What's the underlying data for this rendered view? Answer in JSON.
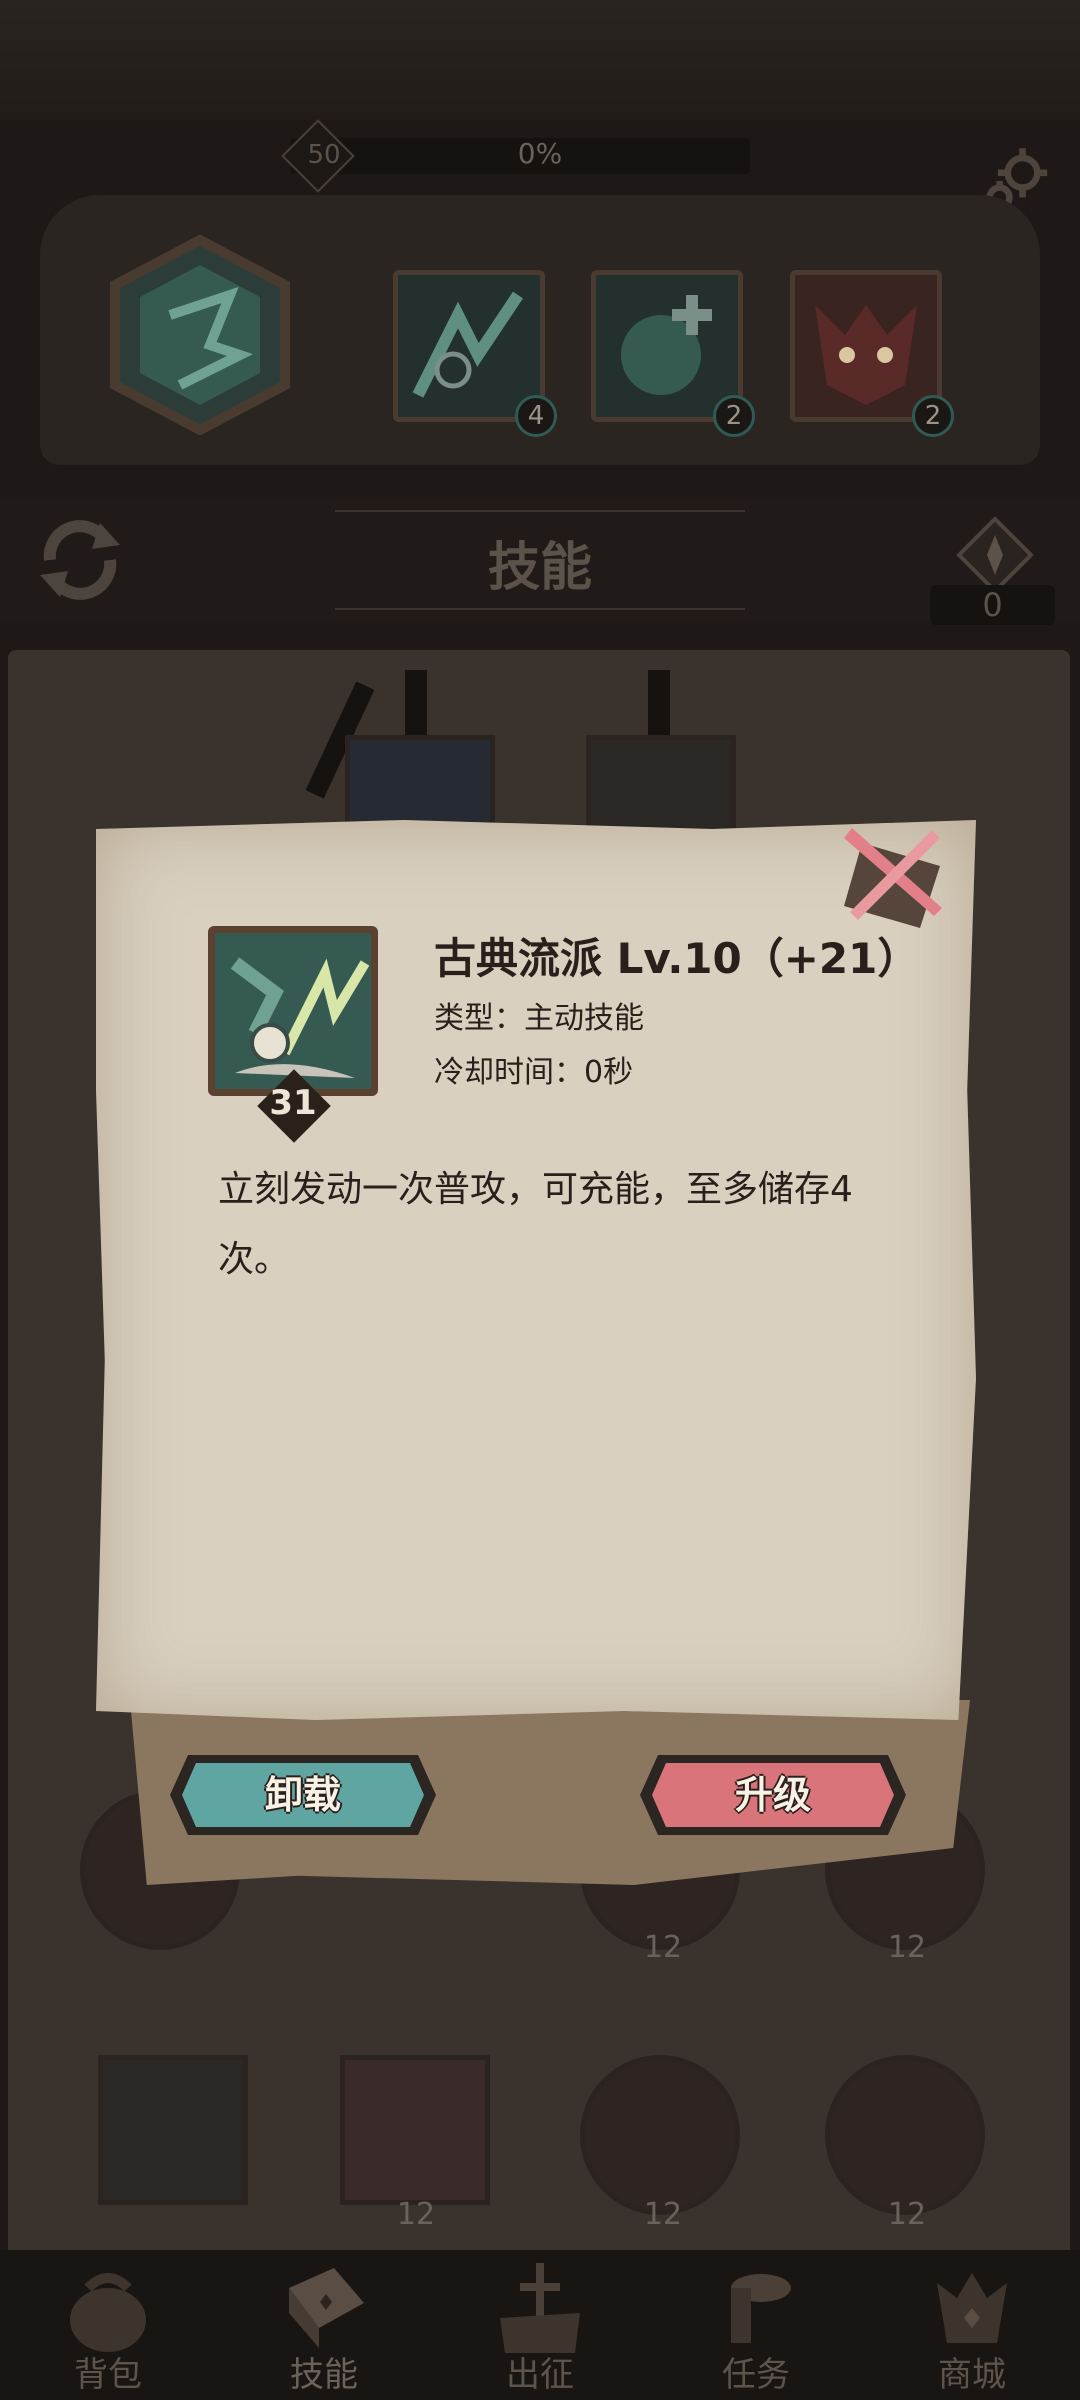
{
  "top_bar": {
    "player_level": "50",
    "progress": "0%"
  },
  "equipment": {
    "slots": [
      {
        "count": "4"
      },
      {
        "count": "2"
      },
      {
        "count": "2"
      }
    ]
  },
  "header": {
    "title": "技能",
    "gem_count": "0"
  },
  "background_nodes": {
    "counts": [
      "12",
      "12",
      "12",
      "12",
      "12"
    ]
  },
  "dialog": {
    "skill_name": "古典流派  Lv.10（+21）",
    "skill_type": "类型：主动技能",
    "cooldown": "冷却时间：0秒",
    "icon_level": "31",
    "description": "立刻发动一次普攻，可充能，至多储存4次。",
    "unequip_label": "卸载",
    "upgrade_label": "升级",
    "colors": {
      "unequip": "#5fa6a2",
      "upgrade": "#d9747a"
    }
  },
  "nav": {
    "items": [
      {
        "label": "背包",
        "icon": "bag-icon"
      },
      {
        "label": "技能",
        "icon": "book-icon"
      },
      {
        "label": "出征",
        "icon": "sword-icon"
      },
      {
        "label": "任务",
        "icon": "scroll-icon"
      },
      {
        "label": "商城",
        "icon": "shop-icon"
      }
    ]
  }
}
